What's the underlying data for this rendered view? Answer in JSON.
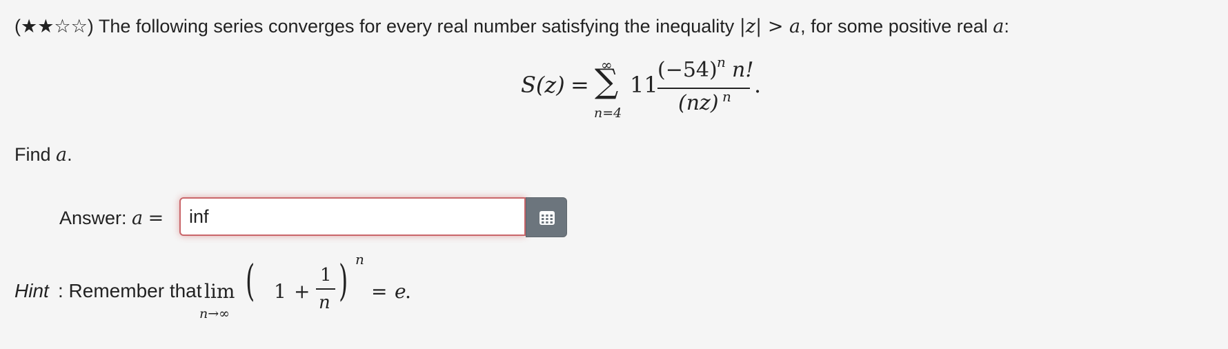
{
  "problem": {
    "stars": "(★★☆☆)",
    "text_before": " The following series converges for every real number satisfying the inequality ",
    "abs_left": "|",
    "abs_var": "z",
    "abs_right": "|",
    "gt": " > ",
    "var_a": "a",
    "text_after": ", for some positive real ",
    "var_a2": "a",
    "colon": ":"
  },
  "formula": {
    "lhs": "S(z)",
    "equals": "=",
    "sum_sign": "∑",
    "upper_limit": "∞",
    "lower_limit": "n=4",
    "coefficient": "11",
    "numerator": "(−54)",
    "numerator_exp": "n",
    "numerator_fact": "n!",
    "denominator": "(nz)",
    "denominator_exp": "n",
    "period": "."
  },
  "find": {
    "text": "Find ",
    "var": "a",
    "period": "."
  },
  "answer": {
    "label": "Answer: ",
    "var": "a",
    "equals": "=",
    "value": "inf",
    "button_icon": "matrix-grid-icon"
  },
  "hint": {
    "label": "Hint",
    "text": ": Remember that ",
    "lim": "lim",
    "lim_sub": "n→∞",
    "lparen": "(",
    "one": "1",
    "plus": "+",
    "frac_num": "1",
    "frac_den": "n",
    "rparen": ")",
    "exp": "n",
    "equals": "=",
    "e": "e",
    "period": "."
  },
  "colors": {
    "background": "#f5f5f5",
    "input_border_error": "#c9666a",
    "button_bg": "#6c757d"
  }
}
